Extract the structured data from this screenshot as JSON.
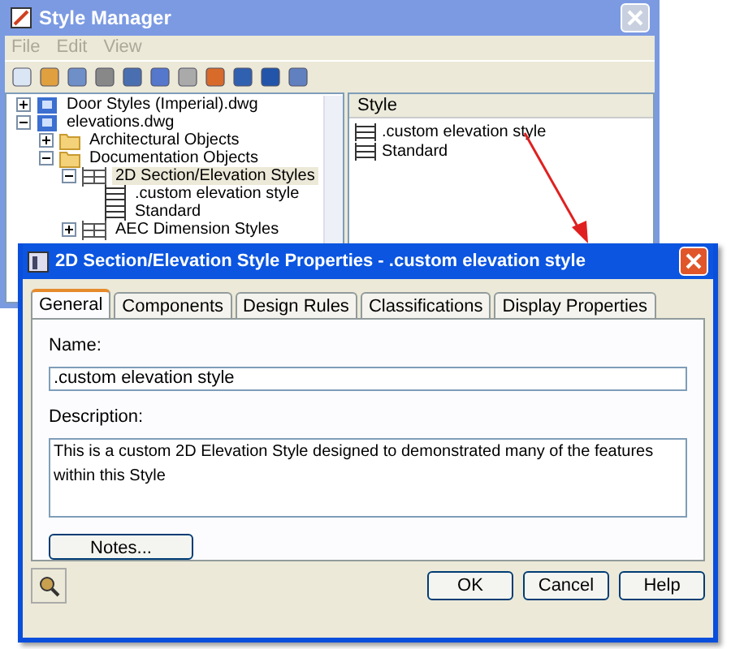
{
  "style_manager": {
    "title": "Style Manager",
    "menu": [
      {
        "label": "File",
        "disabled": true
      },
      {
        "label": "Edit",
        "disabled": true
      },
      {
        "label": "View",
        "disabled": true
      }
    ],
    "tree": [
      {
        "label": "Door Styles (Imperial).dwg",
        "kind": "drawing",
        "expanded": false,
        "selected": false
      },
      {
        "label": "elevations.dwg",
        "kind": "drawing",
        "expanded": true,
        "selected": false,
        "children": [
          {
            "label": "Architectural Objects",
            "kind": "folder",
            "expanded": false,
            "selected": false
          },
          {
            "label": "Documentation Objects",
            "kind": "folder",
            "expanded": true,
            "selected": false,
            "children": [
              {
                "label": "2D Section/Elevation Styles",
                "kind": "category",
                "expanded": true,
                "selected": true,
                "children": [
                  {
                    "label": ".custom elevation style",
                    "kind": "style",
                    "selected": false
                  },
                  {
                    "label": "Standard",
                    "kind": "style",
                    "selected": false
                  }
                ]
              },
              {
                "label": "AEC Dimension Styles",
                "kind": "category",
                "expanded": false,
                "selected": false
              }
            ]
          }
        ]
      }
    ],
    "list": {
      "column": "Style",
      "items": [
        {
          "label": ".custom elevation style"
        },
        {
          "label": "Standard"
        }
      ]
    }
  },
  "dialog": {
    "title": "2D Section/Elevation Style Properties - .custom elevation style",
    "tabs": [
      {
        "label": "General",
        "selected": true
      },
      {
        "label": "Components",
        "selected": false
      },
      {
        "label": "Design Rules",
        "selected": false
      },
      {
        "label": "Classifications",
        "selected": false
      },
      {
        "label": "Display Properties",
        "selected": false
      }
    ],
    "name_label": "Name:",
    "name_value": ".custom elevation style",
    "description_label": "Description:",
    "description_value": "This is a custom 2D Elevation Style designed to demonstrated many of the features within this Style",
    "notes_button": "Notes...",
    "buttons": [
      "OK",
      "Cancel",
      "Help"
    ]
  }
}
